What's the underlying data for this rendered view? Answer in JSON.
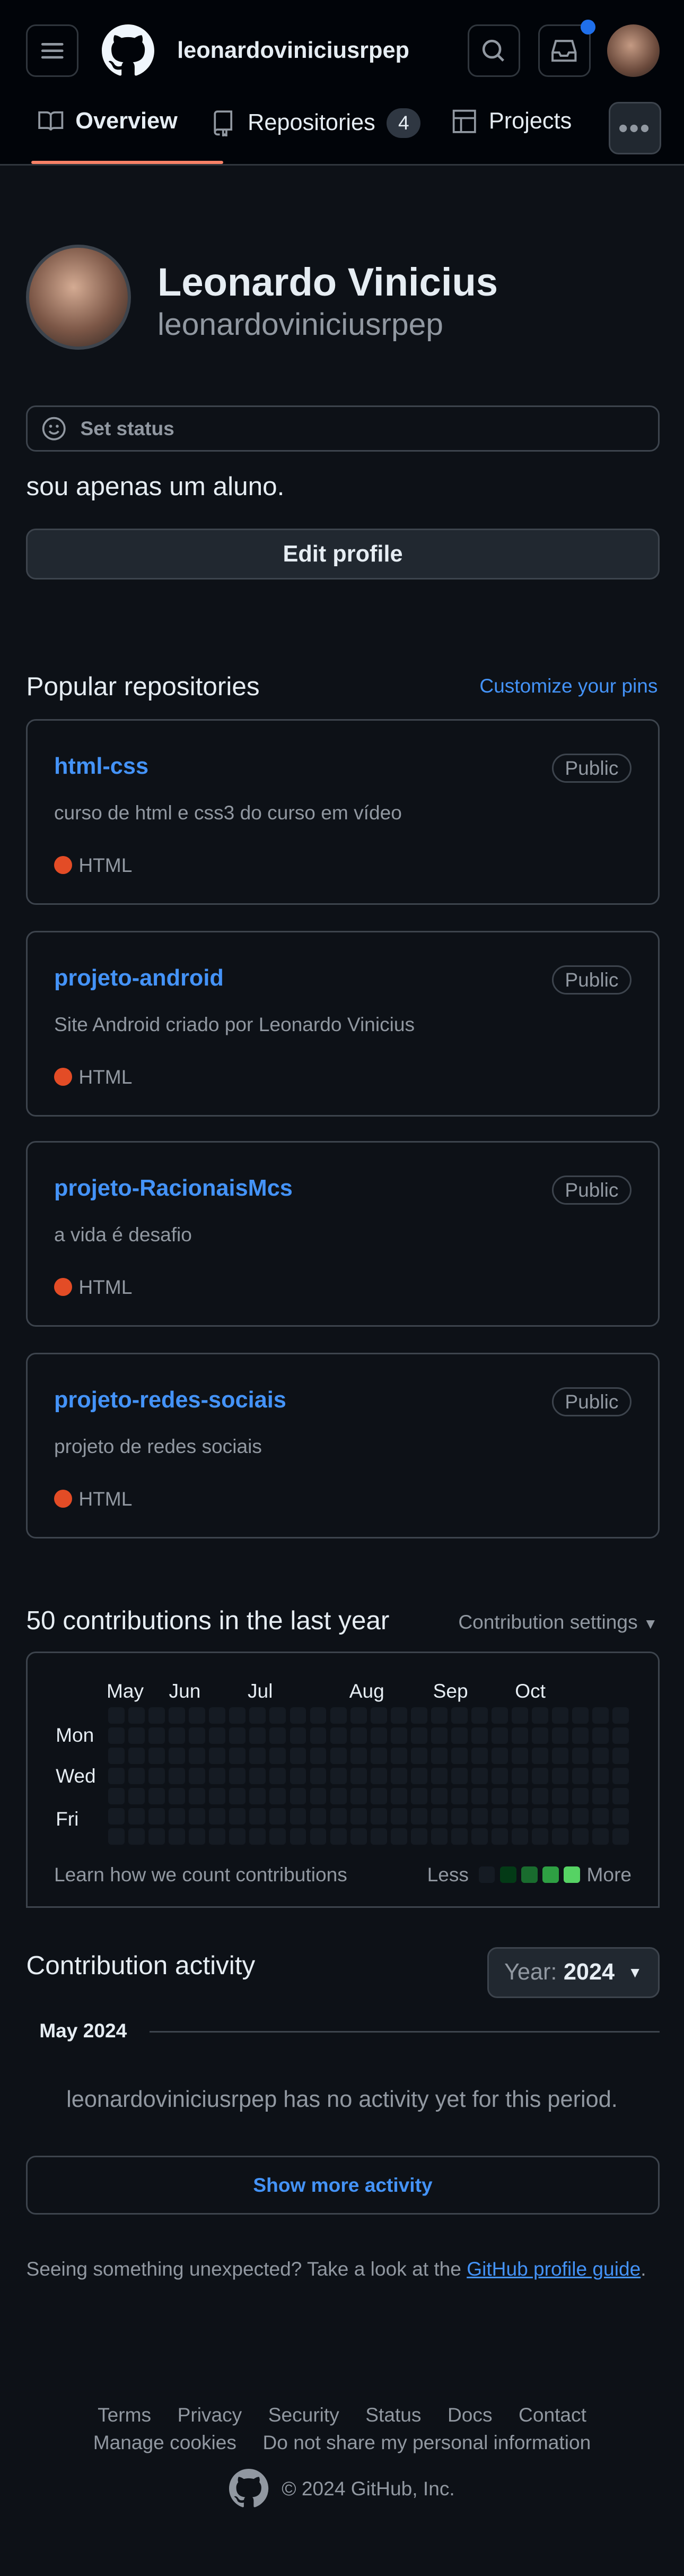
{
  "header": {
    "username": "leonardoviniciusrpep",
    "notification_dot_color": "#1f6feb"
  },
  "tabs": [
    {
      "label": "Overview",
      "active": true
    },
    {
      "label": "Repositories",
      "count": "4"
    },
    {
      "label": "Projects"
    }
  ],
  "profile": {
    "name": "Leonardo Vinicius",
    "login": "leonardoviniciusrpep",
    "status_label": "Set status",
    "bio": "sou apenas um aluno.",
    "edit_label": "Edit profile"
  },
  "popular": {
    "title": "Popular repositories",
    "customize": "Customize your pins",
    "repos": [
      {
        "name": "html-css",
        "visibility": "Public",
        "description": "curso de html e css3 do curso em vídeo",
        "language": "HTML"
      },
      {
        "name": "projeto-android",
        "visibility": "Public",
        "description": "Site Android criado por Leonardo Vinicius",
        "language": "HTML"
      },
      {
        "name": "projeto-RacionaisMcs",
        "visibility": "Public",
        "description": "a vida é desafio",
        "language": "HTML"
      },
      {
        "name": "projeto-redes-sociais",
        "visibility": "Public",
        "description": "projeto de redes sociais",
        "language": "HTML"
      }
    ]
  },
  "contributions": {
    "title": "50 contributions in the last year",
    "settings": "Contribution settings",
    "months": [
      "May",
      "Jun",
      "Jul",
      "Aug",
      "Sep",
      "Oct"
    ],
    "days": [
      "Mon",
      "Wed",
      "Fri"
    ],
    "learn": "Learn how we count contributions",
    "less": "Less",
    "more": "More",
    "legend_colors": [
      "#151b23",
      "#033a16",
      "#196c2e",
      "#2ea043",
      "#56d364"
    ]
  },
  "activity": {
    "title": "Contribution activity",
    "year_label": "Year:",
    "year": "2024",
    "month": "May 2024",
    "empty": "leonardoviniciusrpep has no activity yet for this period.",
    "show_more": "Show more activity"
  },
  "guide": {
    "text": "Seeing something unexpected? Take a look at the ",
    "link": "GitHub profile guide",
    "end": "."
  },
  "footer": {
    "links": [
      "Terms",
      "Privacy",
      "Security",
      "Status",
      "Docs",
      "Contact"
    ],
    "links2": [
      "Manage cookies",
      "Do not share my personal information"
    ],
    "copyright": "© 2024 GitHub, Inc."
  }
}
